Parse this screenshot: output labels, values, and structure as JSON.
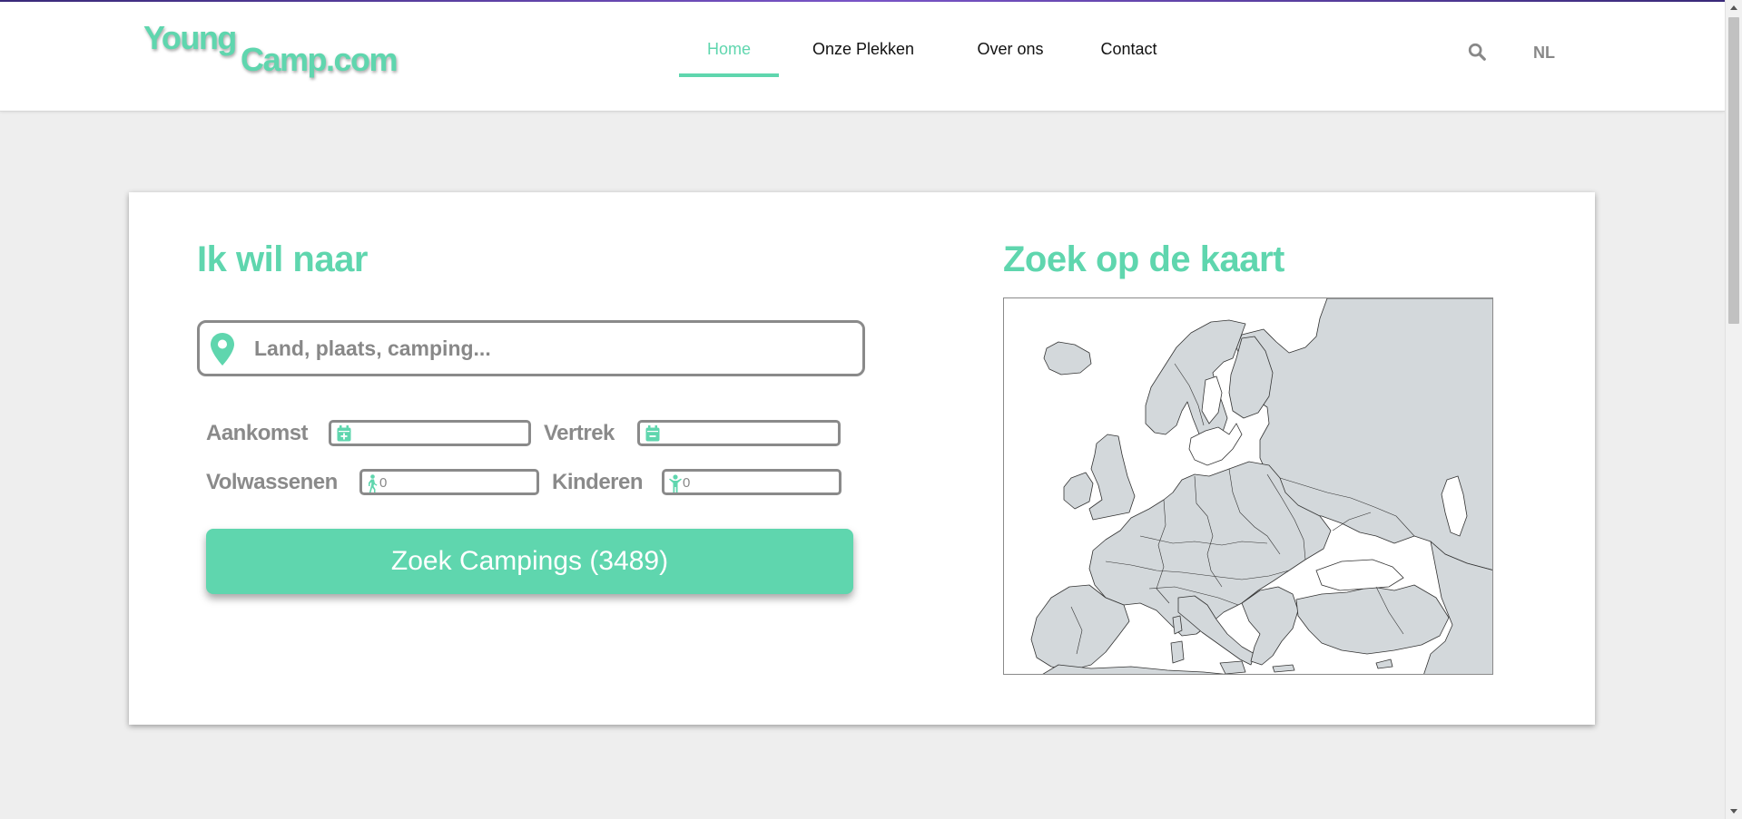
{
  "header": {
    "logo_line1": "Young",
    "logo_line2": "Camp.com",
    "nav": [
      {
        "label": "Home"
      },
      {
        "label": "Onze Plekken"
      },
      {
        "label": "Over ons"
      },
      {
        "label": "Contact"
      }
    ],
    "language": "NL"
  },
  "search": {
    "heading": "Ik wil naar",
    "destination_placeholder": "Land, plaats, camping...",
    "destination_value": "",
    "arrival_label": "Aankomst",
    "arrival_value": "",
    "departure_label": "Vertrek",
    "departure_value": "",
    "adults_label": "Volwassenen",
    "adults_value": "0",
    "children_label": "Kinderen",
    "children_value": "0",
    "button_label": "Zoek Campings (3489)"
  },
  "map": {
    "heading": "Zoek op de kaart"
  },
  "colors": {
    "accent": "#5fd6ae",
    "text_muted": "#8a8a8a",
    "map_land": "#d3d8db",
    "map_border": "#333333"
  },
  "icons": [
    "search-icon",
    "map-pin-icon",
    "calendar-plus-icon",
    "calendar-minus-icon",
    "adult-walking-icon",
    "child-icon"
  ]
}
